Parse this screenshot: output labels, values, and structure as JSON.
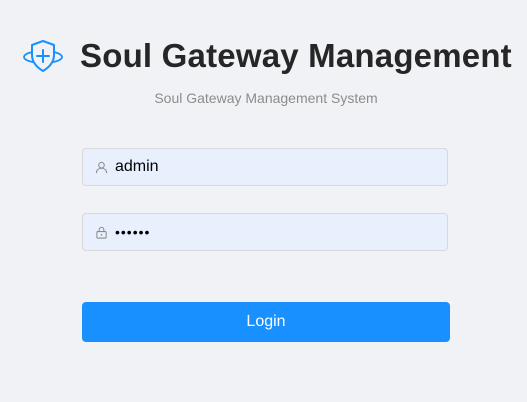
{
  "header": {
    "title": "Soul Gateway Management",
    "subtitle": "Soul Gateway Management System",
    "logo_icon": "shield-plus-icon"
  },
  "form": {
    "username": {
      "icon": "user-icon",
      "value": "admin"
    },
    "password": {
      "icon": "lock-icon",
      "value": "123456"
    },
    "login_label": "Login"
  },
  "colors": {
    "accent": "#1890ff",
    "logo": "#1890ff",
    "background": "#f0f2f5",
    "input_fill": "#e8f0fe"
  }
}
